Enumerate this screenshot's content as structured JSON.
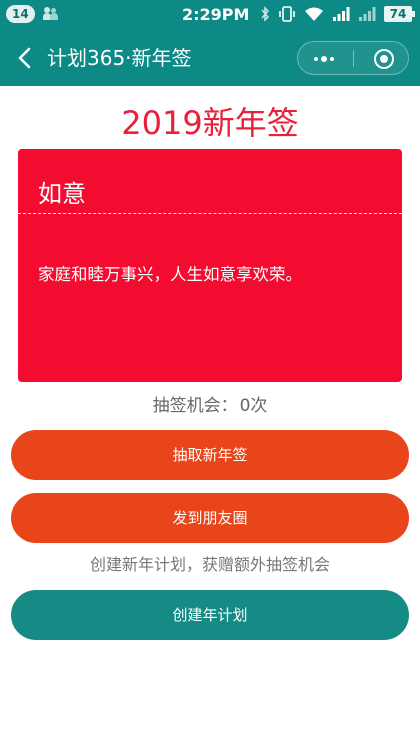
{
  "status_bar": {
    "notification_count": "14",
    "time": "2:29PM",
    "battery": "74",
    "icons": [
      "people-icon",
      "bluetooth-icon",
      "vibrate-icon",
      "wifi-icon",
      "signal-icon",
      "signal-icon",
      "battery-icon"
    ]
  },
  "nav": {
    "title": "计划365·新年签",
    "back_icon": "chevron-left-icon",
    "more_icon": "more-dots-icon",
    "close_icon": "target-circle-icon"
  },
  "page": {
    "title": "2019新年签"
  },
  "card": {
    "heading": "如意",
    "text": "家庭和睦万事兴，人生如意享欢荣。"
  },
  "chance": {
    "label": "抽签机会：",
    "count": "0次"
  },
  "buttons": {
    "draw": "抽取新年签",
    "share": "发到朋友圈",
    "create": "创建年计划"
  },
  "promo": "创建新年计划，获赠额外抽签机会",
  "colors": {
    "header": "#0e8a86",
    "title_red": "#e8203a",
    "card_red": "#f30c2f",
    "button_orange": "#e8451a",
    "button_teal": "#168b85"
  }
}
